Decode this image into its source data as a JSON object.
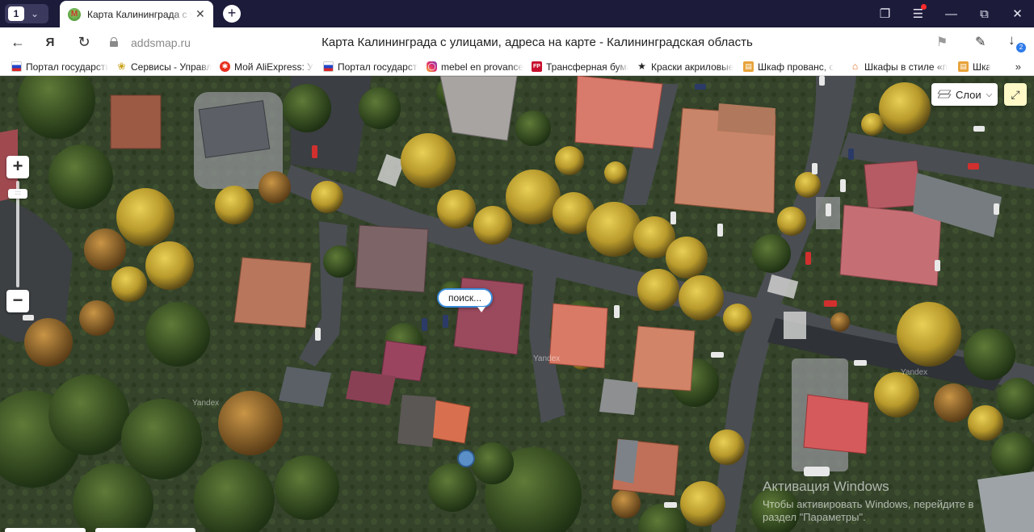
{
  "browser": {
    "tab_count": "1",
    "tab_title": "Карта Калининграда с улицами",
    "new_tab_symbol": "+",
    "notification_dot_color": "#ff2a2a"
  },
  "address_bar": {
    "domain": "addsmap.ru",
    "page_title": "Карта Калининграда с улицами, адреса на карте - Калининградская область",
    "downloads_badge": "2"
  },
  "bookmarks": {
    "items": [
      {
        "label": "Портал государственных",
        "icon": "russia-flag-icon"
      },
      {
        "label": "Сервисы - Управление",
        "icon": "emblem-icon"
      },
      {
        "label": "Мой AliExpress: У",
        "icon": "aliexpress-icon"
      },
      {
        "label": "Портал государственных",
        "icon": "russia-flag-icon"
      },
      {
        "label": "mebel en provance",
        "icon": "instagram-icon"
      },
      {
        "label": "Трансферная бумага",
        "icon": "fp-icon"
      },
      {
        "label": "Краски акриловые",
        "icon": "star-icon"
      },
      {
        "label": "Шкаф прованс, с",
        "icon": "cabinet-icon"
      },
      {
        "label": "Шкафы в стиле «п",
        "icon": "house-icon"
      },
      {
        "label": "Шка",
        "icon": "cabinet-icon"
      }
    ],
    "more_symbol": "»"
  },
  "map": {
    "layers_label": "Слои",
    "search_marker_label": "поиск...",
    "watermarks": [
      "Yandex",
      "Yandex",
      "Yandex"
    ]
  },
  "windows_activation": {
    "title": "Активация Windows",
    "line1": "Чтобы активировать Windows, перейдите в",
    "line2": "раздел \"Параметры\"."
  }
}
